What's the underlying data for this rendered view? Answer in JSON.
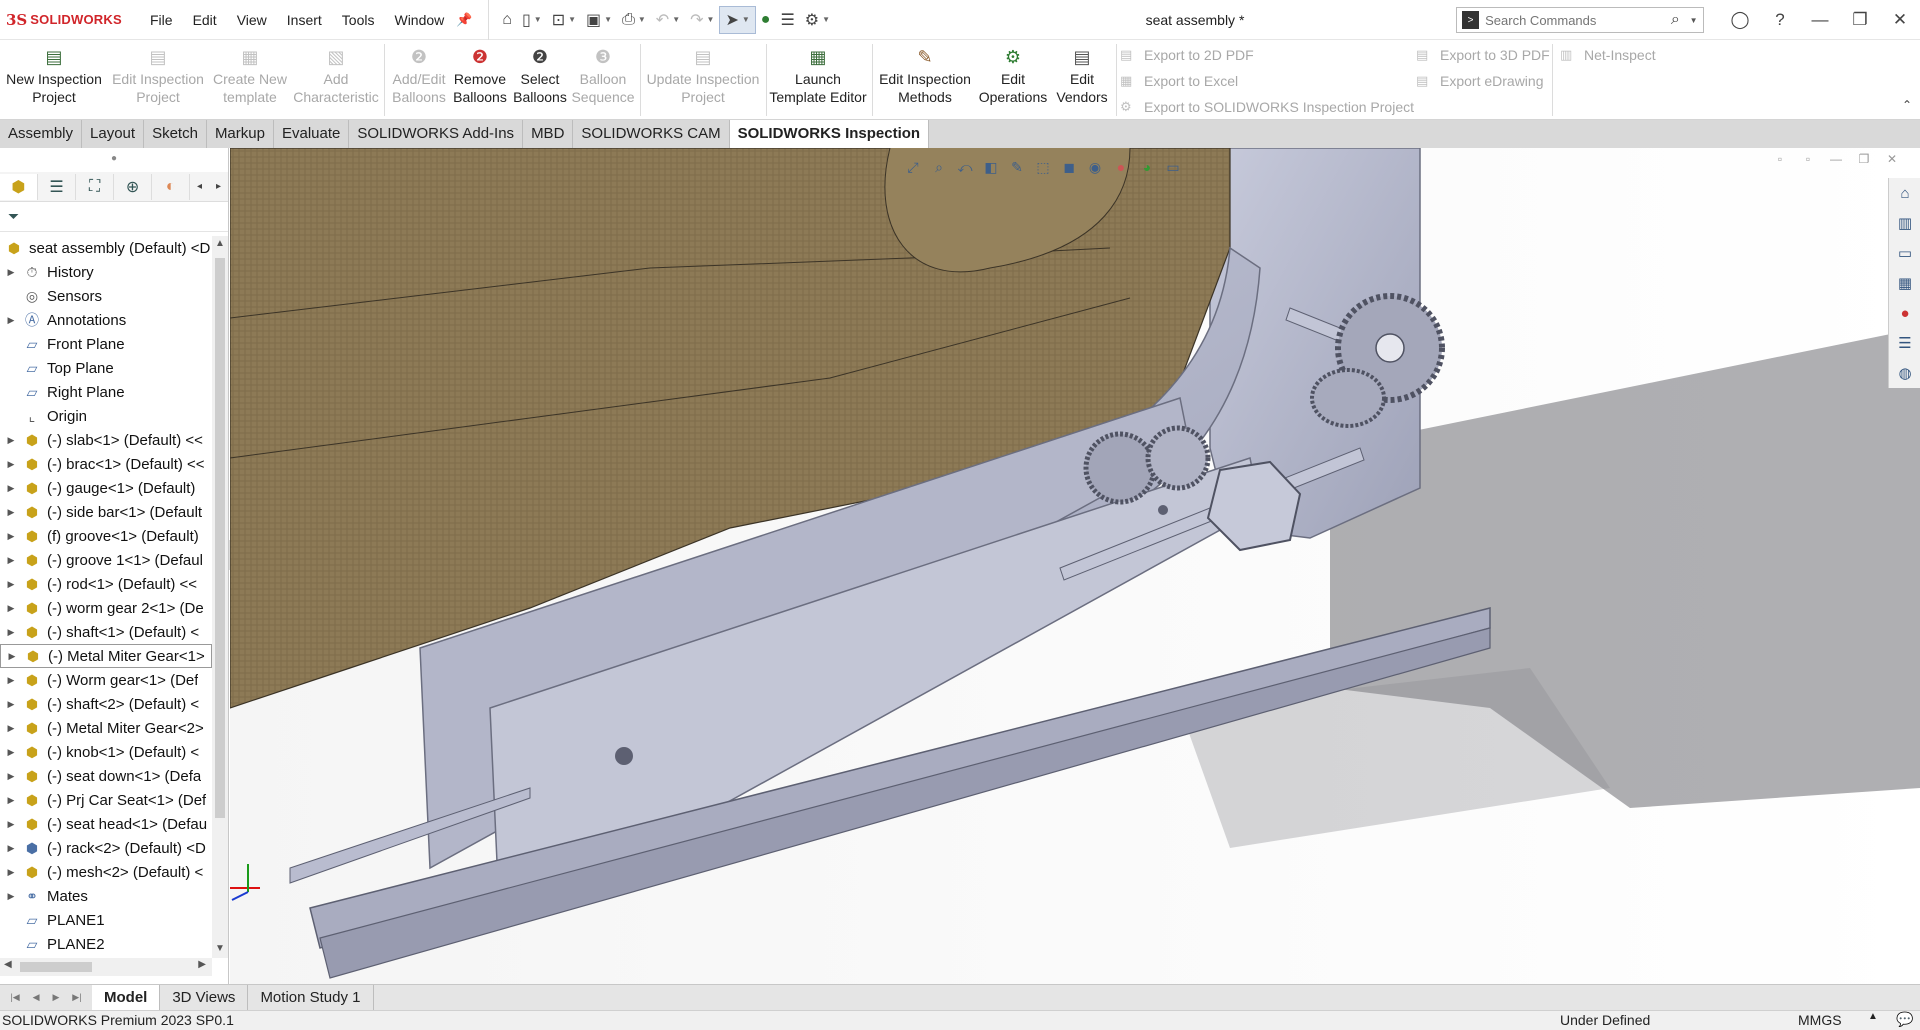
{
  "app": {
    "logo_mark": "3S",
    "logo_text": "SOLIDWORKS",
    "document_title": "seat assembly *"
  },
  "menu": [
    "File",
    "Edit",
    "View",
    "Insert",
    "Tools",
    "Window"
  ],
  "search": {
    "placeholder": "Search Commands"
  },
  "command_manager": {
    "buttons": [
      {
        "label_lines": [
          "New Inspection",
          "Project"
        ],
        "enabled": true,
        "icon": "new-inspection-icon"
      },
      {
        "label_lines": [
          "Edit Inspection",
          "Project"
        ],
        "enabled": false,
        "icon": "edit-inspection-icon"
      },
      {
        "label_lines": [
          "Create New",
          "template"
        ],
        "enabled": false,
        "icon": "template-icon"
      },
      {
        "label_lines": [
          "Add",
          "Characteristic"
        ],
        "enabled": false,
        "icon": "characteristic-icon"
      },
      {
        "label_lines": [
          "Add/Edit",
          "Balloons"
        ],
        "enabled": false,
        "icon": "balloon-icon"
      },
      {
        "label_lines": [
          "Remove",
          "Balloons"
        ],
        "enabled": true,
        "icon": "remove-balloon-icon"
      },
      {
        "label_lines": [
          "Select",
          "Balloons"
        ],
        "enabled": true,
        "icon": "select-balloon-icon"
      },
      {
        "label_lines": [
          "Balloon",
          "Sequence"
        ],
        "enabled": false,
        "icon": "sequence-icon"
      },
      {
        "label_lines": [
          "Update Inspection",
          "Project"
        ],
        "enabled": false,
        "icon": "update-icon"
      },
      {
        "label_lines": [
          "Launch",
          "Template Editor"
        ],
        "enabled": true,
        "icon": "template-editor-icon"
      },
      {
        "label_lines": [
          "Edit Inspection",
          "Methods"
        ],
        "enabled": true,
        "icon": "methods-icon"
      },
      {
        "label_lines": [
          "Edit",
          "Operations"
        ],
        "enabled": true,
        "icon": "operations-icon"
      },
      {
        "label_lines": [
          "Edit",
          "Vendors"
        ],
        "enabled": true,
        "icon": "vendors-icon"
      }
    ],
    "export": {
      "pdf2d": "Export to 2D PDF",
      "excel": "Export to Excel",
      "sw_project": "Export to SOLIDWORKS Inspection Project",
      "pdf3d": "Export to 3D PDF",
      "edrawing": "Export eDrawing",
      "net_inspect": "Net-Inspect"
    }
  },
  "tabs": [
    {
      "label": "Assembly",
      "active": false
    },
    {
      "label": "Layout",
      "active": false
    },
    {
      "label": "Sketch",
      "active": false
    },
    {
      "label": "Markup",
      "active": false
    },
    {
      "label": "Evaluate",
      "active": false
    },
    {
      "label": "SOLIDWORKS Add-Ins",
      "active": false
    },
    {
      "label": "MBD",
      "active": false
    },
    {
      "label": "SOLIDWORKS CAM",
      "active": false
    },
    {
      "label": "SOLIDWORKS Inspection",
      "active": true
    }
  ],
  "feature_tree": {
    "root": "seat assembly (Default) <D",
    "items": [
      {
        "label": "History",
        "icon": "history",
        "expandable": true
      },
      {
        "label": "Sensors",
        "icon": "sensor",
        "expandable": false
      },
      {
        "label": "Annotations",
        "icon": "annotation",
        "expandable": true
      },
      {
        "label": "Front Plane",
        "icon": "plane",
        "expandable": false
      },
      {
        "label": "Top Plane",
        "icon": "plane",
        "expandable": false
      },
      {
        "label": "Right Plane",
        "icon": "plane",
        "expandable": false
      },
      {
        "label": "Origin",
        "icon": "origin",
        "expandable": false
      },
      {
        "label": "(-) slab<1> (Default) <<",
        "icon": "part",
        "expandable": true
      },
      {
        "label": "(-) brac<1> (Default) <<",
        "icon": "part",
        "expandable": true
      },
      {
        "label": "(-) gauge<1> (Default)",
        "icon": "part",
        "expandable": true
      },
      {
        "label": "(-) side bar<1> (Default",
        "icon": "part",
        "expandable": true
      },
      {
        "label": "(f) groove<1> (Default)",
        "icon": "part",
        "expandable": true
      },
      {
        "label": "(-) groove 1<1> (Defaul",
        "icon": "part",
        "expandable": true
      },
      {
        "label": "(-) rod<1> (Default) <<",
        "icon": "part",
        "expandable": true
      },
      {
        "label": "(-) worm gear 2<1> (De",
        "icon": "part",
        "expandable": true
      },
      {
        "label": "(-) shaft<1> (Default) <",
        "icon": "part",
        "expandable": true
      },
      {
        "label": "(-) Metal Miter Gear<1>",
        "icon": "part",
        "expandable": true,
        "selected": true
      },
      {
        "label": "(-) Worm gear<1> (Def",
        "icon": "part",
        "expandable": true
      },
      {
        "label": "(-) shaft<2> (Default) <",
        "icon": "part",
        "expandable": true
      },
      {
        "label": "(-) Metal Miter Gear<2>",
        "icon": "part",
        "expandable": true
      },
      {
        "label": "(-) knob<1> (Default) <",
        "icon": "part",
        "expandable": true
      },
      {
        "label": "(-) seat down<1> (Defa",
        "icon": "part",
        "expandable": true
      },
      {
        "label": "(-) Prj Car Seat<1> (Def",
        "icon": "part",
        "expandable": true
      },
      {
        "label": "(-) seat head<1> (Defau",
        "icon": "part",
        "expandable": true
      },
      {
        "label": "(-) rack<2> (Default) <D",
        "icon": "subassembly",
        "expandable": true
      },
      {
        "label": "(-) mesh<2> (Default) <",
        "icon": "part",
        "expandable": true
      },
      {
        "label": "Mates",
        "icon": "mates",
        "expandable": true
      },
      {
        "label": "PLANE1",
        "icon": "plane",
        "expandable": false
      },
      {
        "label": "PLANE2",
        "icon": "plane",
        "expandable": false
      }
    ]
  },
  "bottom_tabs": [
    {
      "label": "Model",
      "active": true
    },
    {
      "label": "3D Views",
      "active": false
    },
    {
      "label": "Motion Study 1",
      "active": false
    }
  ],
  "status": {
    "product": "SOLIDWORKS Premium 2023 SP0.1",
    "state": "Under Defined",
    "units": "MMGS"
  },
  "colors": {
    "seat_fabric": "#8d7a56",
    "steel": "#b9bccf",
    "accent_red": "#d1252a",
    "selected_tab": "#ffffff"
  }
}
